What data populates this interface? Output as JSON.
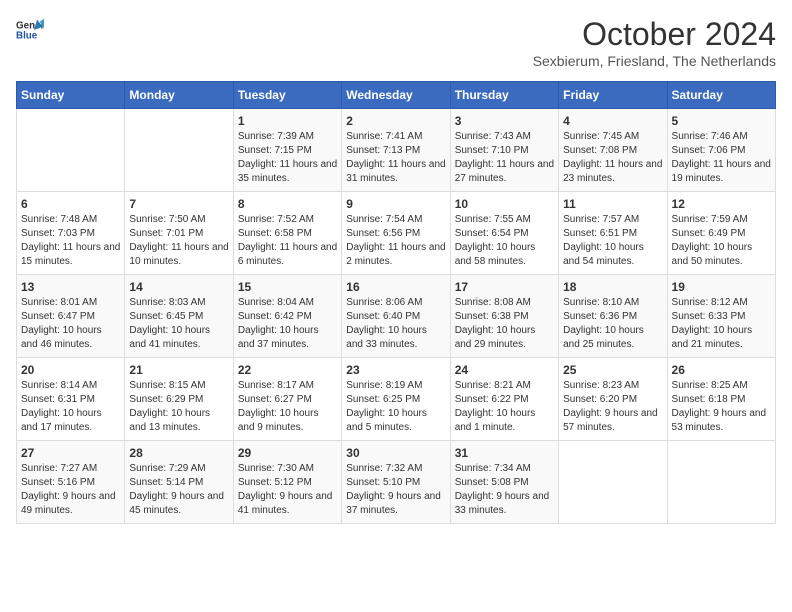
{
  "header": {
    "logo_general": "General",
    "logo_blue": "Blue",
    "title": "October 2024",
    "subtitle": "Sexbierum, Friesland, The Netherlands"
  },
  "days_of_week": [
    "Sunday",
    "Monday",
    "Tuesday",
    "Wednesday",
    "Thursday",
    "Friday",
    "Saturday"
  ],
  "weeks": [
    [
      {
        "day": "",
        "sunrise": "",
        "sunset": "",
        "daylight": ""
      },
      {
        "day": "",
        "sunrise": "",
        "sunset": "",
        "daylight": ""
      },
      {
        "day": "1",
        "sunrise": "Sunrise: 7:39 AM",
        "sunset": "Sunset: 7:15 PM",
        "daylight": "Daylight: 11 hours and 35 minutes."
      },
      {
        "day": "2",
        "sunrise": "Sunrise: 7:41 AM",
        "sunset": "Sunset: 7:13 PM",
        "daylight": "Daylight: 11 hours and 31 minutes."
      },
      {
        "day": "3",
        "sunrise": "Sunrise: 7:43 AM",
        "sunset": "Sunset: 7:10 PM",
        "daylight": "Daylight: 11 hours and 27 minutes."
      },
      {
        "day": "4",
        "sunrise": "Sunrise: 7:45 AM",
        "sunset": "Sunset: 7:08 PM",
        "daylight": "Daylight: 11 hours and 23 minutes."
      },
      {
        "day": "5",
        "sunrise": "Sunrise: 7:46 AM",
        "sunset": "Sunset: 7:06 PM",
        "daylight": "Daylight: 11 hours and 19 minutes."
      }
    ],
    [
      {
        "day": "6",
        "sunrise": "Sunrise: 7:48 AM",
        "sunset": "Sunset: 7:03 PM",
        "daylight": "Daylight: 11 hours and 15 minutes."
      },
      {
        "day": "7",
        "sunrise": "Sunrise: 7:50 AM",
        "sunset": "Sunset: 7:01 PM",
        "daylight": "Daylight: 11 hours and 10 minutes."
      },
      {
        "day": "8",
        "sunrise": "Sunrise: 7:52 AM",
        "sunset": "Sunset: 6:58 PM",
        "daylight": "Daylight: 11 hours and 6 minutes."
      },
      {
        "day": "9",
        "sunrise": "Sunrise: 7:54 AM",
        "sunset": "Sunset: 6:56 PM",
        "daylight": "Daylight: 11 hours and 2 minutes."
      },
      {
        "day": "10",
        "sunrise": "Sunrise: 7:55 AM",
        "sunset": "Sunset: 6:54 PM",
        "daylight": "Daylight: 10 hours and 58 minutes."
      },
      {
        "day": "11",
        "sunrise": "Sunrise: 7:57 AM",
        "sunset": "Sunset: 6:51 PM",
        "daylight": "Daylight: 10 hours and 54 minutes."
      },
      {
        "day": "12",
        "sunrise": "Sunrise: 7:59 AM",
        "sunset": "Sunset: 6:49 PM",
        "daylight": "Daylight: 10 hours and 50 minutes."
      }
    ],
    [
      {
        "day": "13",
        "sunrise": "Sunrise: 8:01 AM",
        "sunset": "Sunset: 6:47 PM",
        "daylight": "Daylight: 10 hours and 46 minutes."
      },
      {
        "day": "14",
        "sunrise": "Sunrise: 8:03 AM",
        "sunset": "Sunset: 6:45 PM",
        "daylight": "Daylight: 10 hours and 41 minutes."
      },
      {
        "day": "15",
        "sunrise": "Sunrise: 8:04 AM",
        "sunset": "Sunset: 6:42 PM",
        "daylight": "Daylight: 10 hours and 37 minutes."
      },
      {
        "day": "16",
        "sunrise": "Sunrise: 8:06 AM",
        "sunset": "Sunset: 6:40 PM",
        "daylight": "Daylight: 10 hours and 33 minutes."
      },
      {
        "day": "17",
        "sunrise": "Sunrise: 8:08 AM",
        "sunset": "Sunset: 6:38 PM",
        "daylight": "Daylight: 10 hours and 29 minutes."
      },
      {
        "day": "18",
        "sunrise": "Sunrise: 8:10 AM",
        "sunset": "Sunset: 6:36 PM",
        "daylight": "Daylight: 10 hours and 25 minutes."
      },
      {
        "day": "19",
        "sunrise": "Sunrise: 8:12 AM",
        "sunset": "Sunset: 6:33 PM",
        "daylight": "Daylight: 10 hours and 21 minutes."
      }
    ],
    [
      {
        "day": "20",
        "sunrise": "Sunrise: 8:14 AM",
        "sunset": "Sunset: 6:31 PM",
        "daylight": "Daylight: 10 hours and 17 minutes."
      },
      {
        "day": "21",
        "sunrise": "Sunrise: 8:15 AM",
        "sunset": "Sunset: 6:29 PM",
        "daylight": "Daylight: 10 hours and 13 minutes."
      },
      {
        "day": "22",
        "sunrise": "Sunrise: 8:17 AM",
        "sunset": "Sunset: 6:27 PM",
        "daylight": "Daylight: 10 hours and 9 minutes."
      },
      {
        "day": "23",
        "sunrise": "Sunrise: 8:19 AM",
        "sunset": "Sunset: 6:25 PM",
        "daylight": "Daylight: 10 hours and 5 minutes."
      },
      {
        "day": "24",
        "sunrise": "Sunrise: 8:21 AM",
        "sunset": "Sunset: 6:22 PM",
        "daylight": "Daylight: 10 hours and 1 minute."
      },
      {
        "day": "25",
        "sunrise": "Sunrise: 8:23 AM",
        "sunset": "Sunset: 6:20 PM",
        "daylight": "Daylight: 9 hours and 57 minutes."
      },
      {
        "day": "26",
        "sunrise": "Sunrise: 8:25 AM",
        "sunset": "Sunset: 6:18 PM",
        "daylight": "Daylight: 9 hours and 53 minutes."
      }
    ],
    [
      {
        "day": "27",
        "sunrise": "Sunrise: 7:27 AM",
        "sunset": "Sunset: 5:16 PM",
        "daylight": "Daylight: 9 hours and 49 minutes."
      },
      {
        "day": "28",
        "sunrise": "Sunrise: 7:29 AM",
        "sunset": "Sunset: 5:14 PM",
        "daylight": "Daylight: 9 hours and 45 minutes."
      },
      {
        "day": "29",
        "sunrise": "Sunrise: 7:30 AM",
        "sunset": "Sunset: 5:12 PM",
        "daylight": "Daylight: 9 hours and 41 minutes."
      },
      {
        "day": "30",
        "sunrise": "Sunrise: 7:32 AM",
        "sunset": "Sunset: 5:10 PM",
        "daylight": "Daylight: 9 hours and 37 minutes."
      },
      {
        "day": "31",
        "sunrise": "Sunrise: 7:34 AM",
        "sunset": "Sunset: 5:08 PM",
        "daylight": "Daylight: 9 hours and 33 minutes."
      },
      {
        "day": "",
        "sunrise": "",
        "sunset": "",
        "daylight": ""
      },
      {
        "day": "",
        "sunrise": "",
        "sunset": "",
        "daylight": ""
      }
    ]
  ]
}
